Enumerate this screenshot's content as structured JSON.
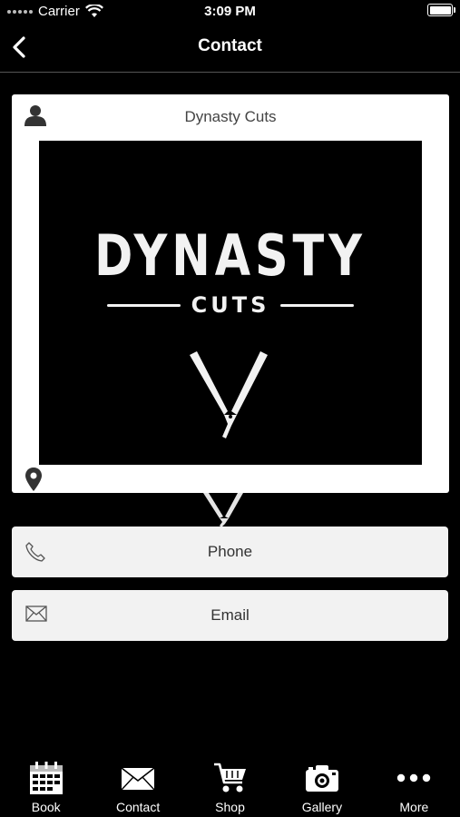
{
  "status": {
    "carrier": "Carrier",
    "time": "3:09 PM"
  },
  "nav": {
    "title": "Contact"
  },
  "card": {
    "title": "Dynasty Cuts",
    "logo_main": "DYNASTY",
    "logo_sub": "CUTS"
  },
  "actions": {
    "phone": "Phone",
    "email": "Email"
  },
  "tabs": [
    {
      "label": "Book",
      "icon": "calendar-icon"
    },
    {
      "label": "Contact",
      "icon": "envelope-icon"
    },
    {
      "label": "Shop",
      "icon": "cart-icon"
    },
    {
      "label": "Gallery",
      "icon": "camera-icon"
    },
    {
      "label": "More",
      "icon": "more-dots-icon"
    }
  ],
  "colors": {
    "background": "#000000",
    "card": "#ffffff",
    "button": "#f2f2f2",
    "text_dark": "#333333"
  }
}
